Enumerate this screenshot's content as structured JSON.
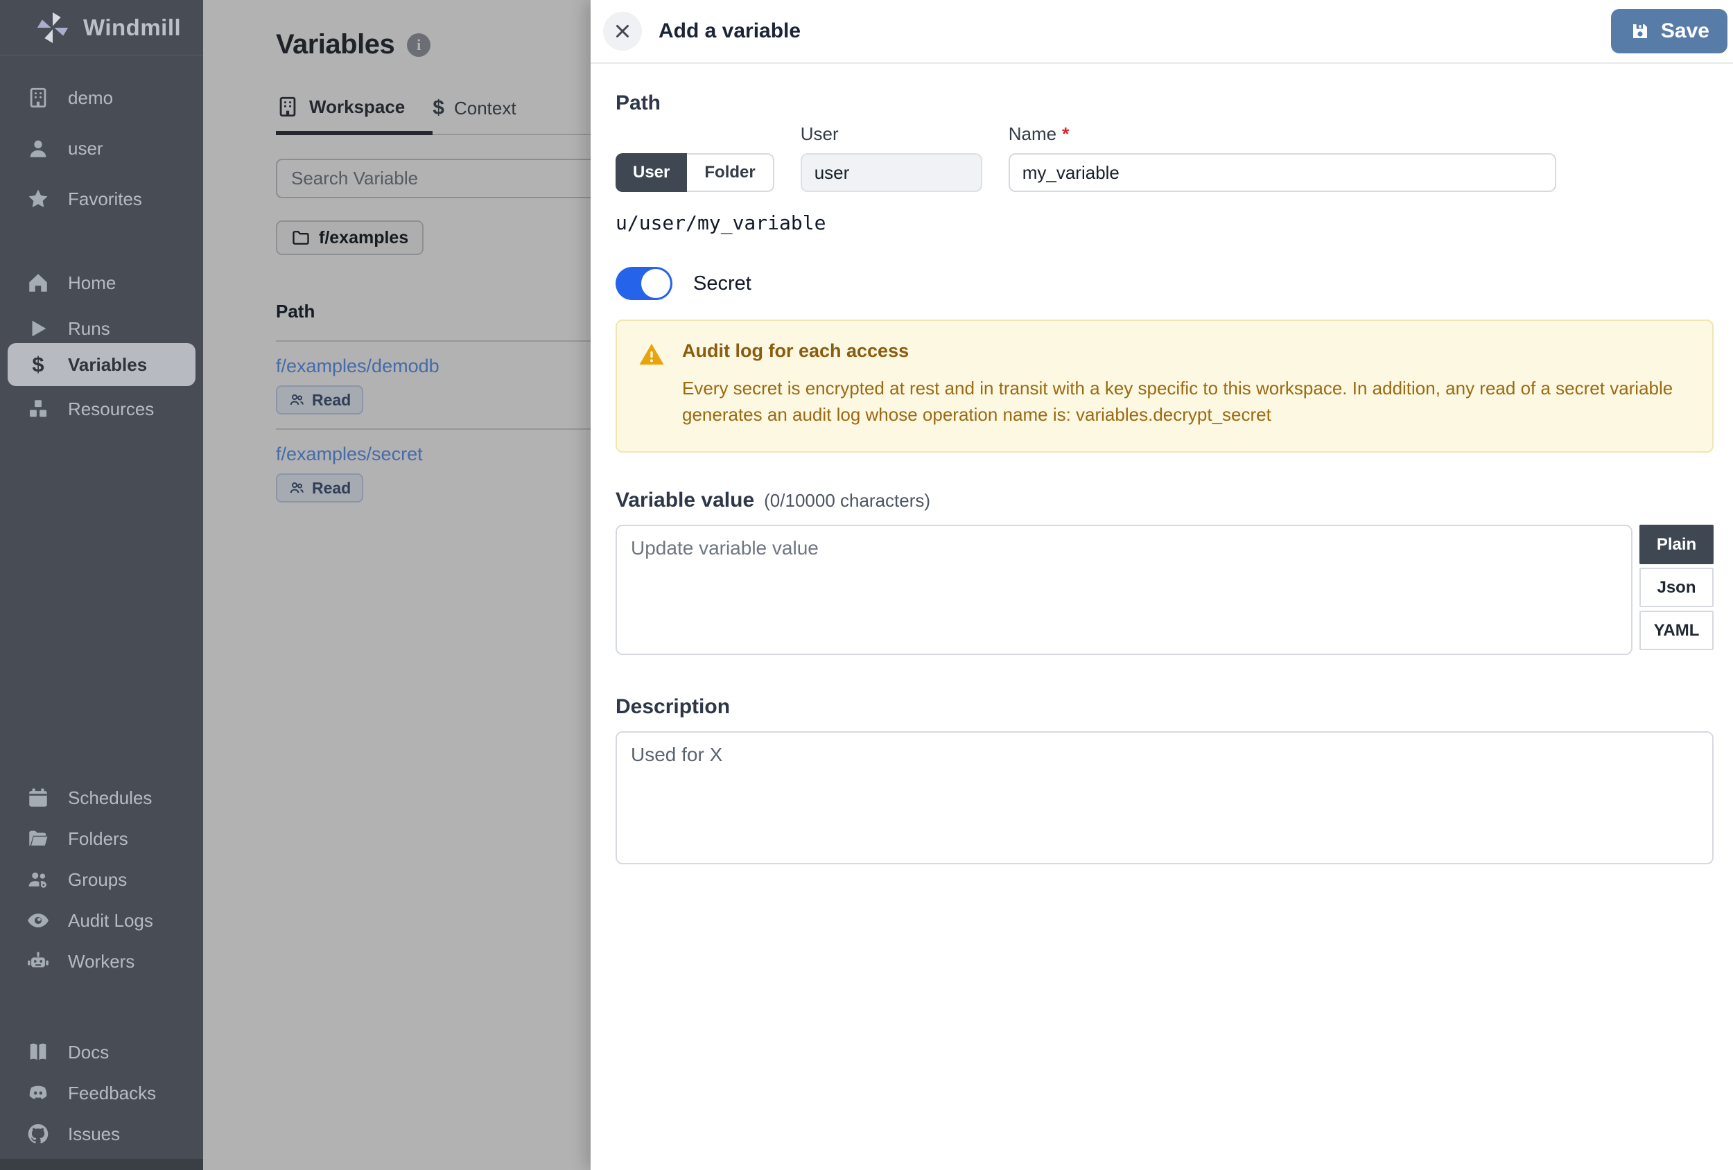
{
  "app": {
    "name": "Windmill"
  },
  "colors": {
    "sidebar_bg": "#474C55",
    "sidebar_active_pill": "#B7BAC0",
    "save_button_blue": "#587CA8",
    "secret_toggle_blue": "#2563EB",
    "segment_selected_bg": "#3F4753",
    "warning_bg": "#FCF8E1",
    "warning_text": "#8A5C10",
    "link_blue": "#639AF5",
    "required_red": "#DC2626"
  },
  "sidebar": {
    "logo_text": "Windmill",
    "workspace_group": [
      {
        "icon": "building-icon",
        "label": "demo"
      },
      {
        "icon": "user-icon",
        "label": "user"
      },
      {
        "icon": "star-icon",
        "label": "Favorites"
      }
    ],
    "primary_group": [
      {
        "icon": "home-icon",
        "label": "Home",
        "active": false
      },
      {
        "icon": "play-icon",
        "label": "Runs",
        "active": false
      },
      {
        "icon": "dollar-icon",
        "label": "Variables",
        "active": true
      },
      {
        "icon": "cubes-icon",
        "label": "Resources",
        "active": false
      }
    ],
    "management_group": [
      {
        "icon": "calendar-icon",
        "label": "Schedules"
      },
      {
        "icon": "folder-icon",
        "label": "Folders"
      },
      {
        "icon": "users-gear-icon",
        "label": "Groups"
      },
      {
        "icon": "eye-icon",
        "label": "Audit Logs"
      },
      {
        "icon": "robot-icon",
        "label": "Workers"
      }
    ],
    "external_group": [
      {
        "icon": "book-icon",
        "label": "Docs"
      },
      {
        "icon": "discord-icon",
        "label": "Feedbacks"
      },
      {
        "icon": "github-icon",
        "label": "Issues"
      }
    ]
  },
  "main": {
    "title": "Variables",
    "tabs": [
      {
        "icon": "building-icon",
        "label": "Workspace",
        "active": true
      },
      {
        "icon": "dollar-icon",
        "label": "Context",
        "active": false
      }
    ],
    "search_placeholder": "Search Variable",
    "folder_chip_label": "f/examples",
    "list": {
      "path_header": "Path",
      "rows": [
        {
          "path": "f/examples/demodb",
          "badge": "Read"
        },
        {
          "path": "f/examples/secret",
          "badge": "Read"
        }
      ]
    }
  },
  "drawer": {
    "title": "Add a variable",
    "save_label": "Save",
    "path_section": {
      "heading": "Path",
      "owner_toggle": {
        "options": [
          "User",
          "Folder"
        ],
        "selected": "User"
      },
      "user_field": {
        "label": "User",
        "value": "user"
      },
      "name_field": {
        "label": "Name",
        "required_mark": "*",
        "value": "my_variable"
      },
      "full_path": "u/user/my_variable"
    },
    "secret_toggle": {
      "label": "Secret",
      "on": true
    },
    "warning": {
      "title": "Audit log for each access",
      "body": "Every secret is encrypted at rest and in transit with a key specific to this workspace. In addition, any read of a secret variable generates an audit log whose operation name is: variables.decrypt_secret"
    },
    "value_section": {
      "heading": "Variable value",
      "counter": "(0/10000 characters)",
      "placeholder": "Update variable value",
      "format_tabs": [
        {
          "label": "Plain",
          "selected": true
        },
        {
          "label": "Json",
          "selected": false
        },
        {
          "label": "YAML",
          "selected": false
        }
      ]
    },
    "description_section": {
      "heading": "Description",
      "placeholder": "Used for X"
    }
  }
}
